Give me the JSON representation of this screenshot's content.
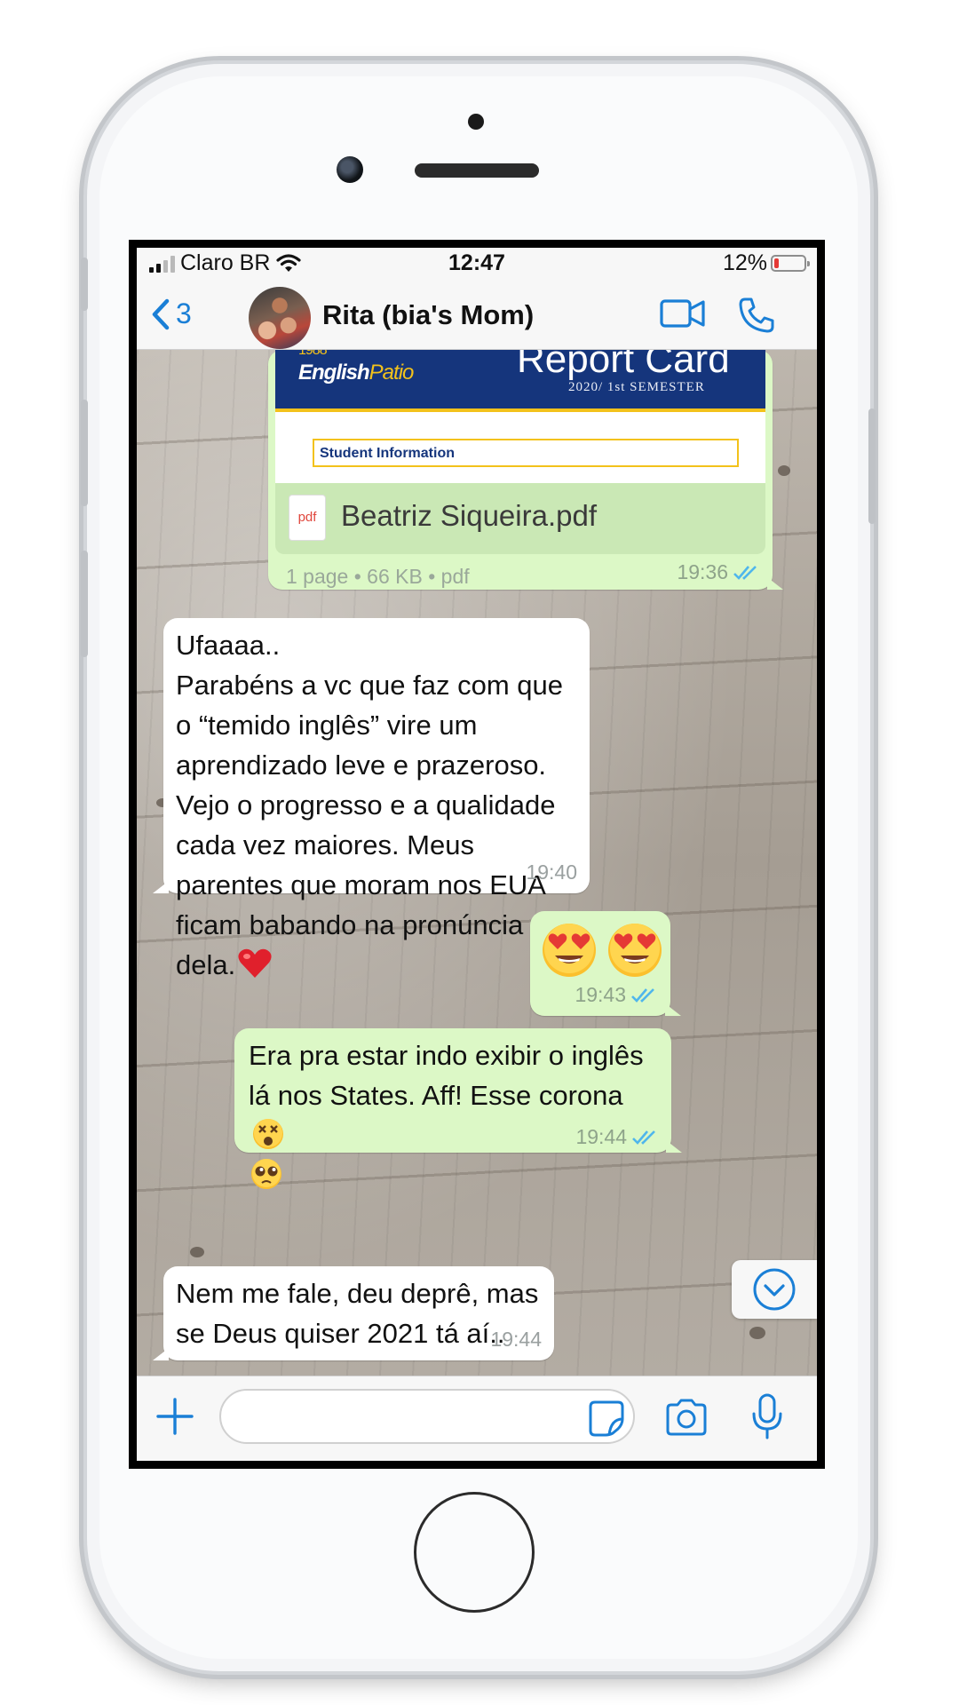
{
  "status_bar": {
    "carrier": "Claro BR",
    "time": "12:47",
    "battery": "12%"
  },
  "nav": {
    "back_count": "3",
    "contact_name": "Rita (bia's Mom)",
    "icons": [
      "chevron-left-icon",
      "video-call-icon",
      "phone-icon"
    ]
  },
  "document": {
    "preview_logo": "English",
    "preview_logo_accent": "Patio",
    "preview_title": "Report Card",
    "preview_subtitle": "2020/ 1st SEMESTER",
    "preview_section": "Student Information",
    "file_type_label": "pdf",
    "file_name": "Beatriz Siqueira.pdf",
    "meta": "1 page • 66 KB • pdf",
    "time": "19:36"
  },
  "messages": [
    {
      "direction": "incoming",
      "text": "Ufaaaa..\nParabéns a vc que faz com que o “temido inglês” vire um aprendizado leve e prazeroso. Vejo o progresso e a qualidade cada vez maiores. Meus parentes que moram nos EUA ficam babando na pronúncia dela.",
      "emoji": "red-heart",
      "time": "19:40"
    },
    {
      "direction": "outgoing",
      "emoji": [
        "heart-eyes",
        "heart-eyes"
      ],
      "time": "19:43"
    },
    {
      "direction": "outgoing",
      "text": "Era pra estar indo exibir o inglês lá nos States. Aff! Esse corona",
      "emoji": [
        "dizzy-face",
        "pleading-face"
      ],
      "time": "19:44"
    },
    {
      "direction": "incoming",
      "text": "Nem me fale, deu deprê, mas se Deus quiser 2021 tá aí..",
      "time": "19:44"
    }
  ],
  "input": {
    "placeholder": "",
    "icons": [
      "plus-icon",
      "sticker-icon",
      "camera-icon",
      "microphone-icon"
    ]
  },
  "colors": {
    "accent": "#1a7fd6",
    "outgoing_bubble": "#dcf8c6",
    "incoming_bubble": "#ffffff",
    "read_ticks": "#4fb6ec"
  }
}
